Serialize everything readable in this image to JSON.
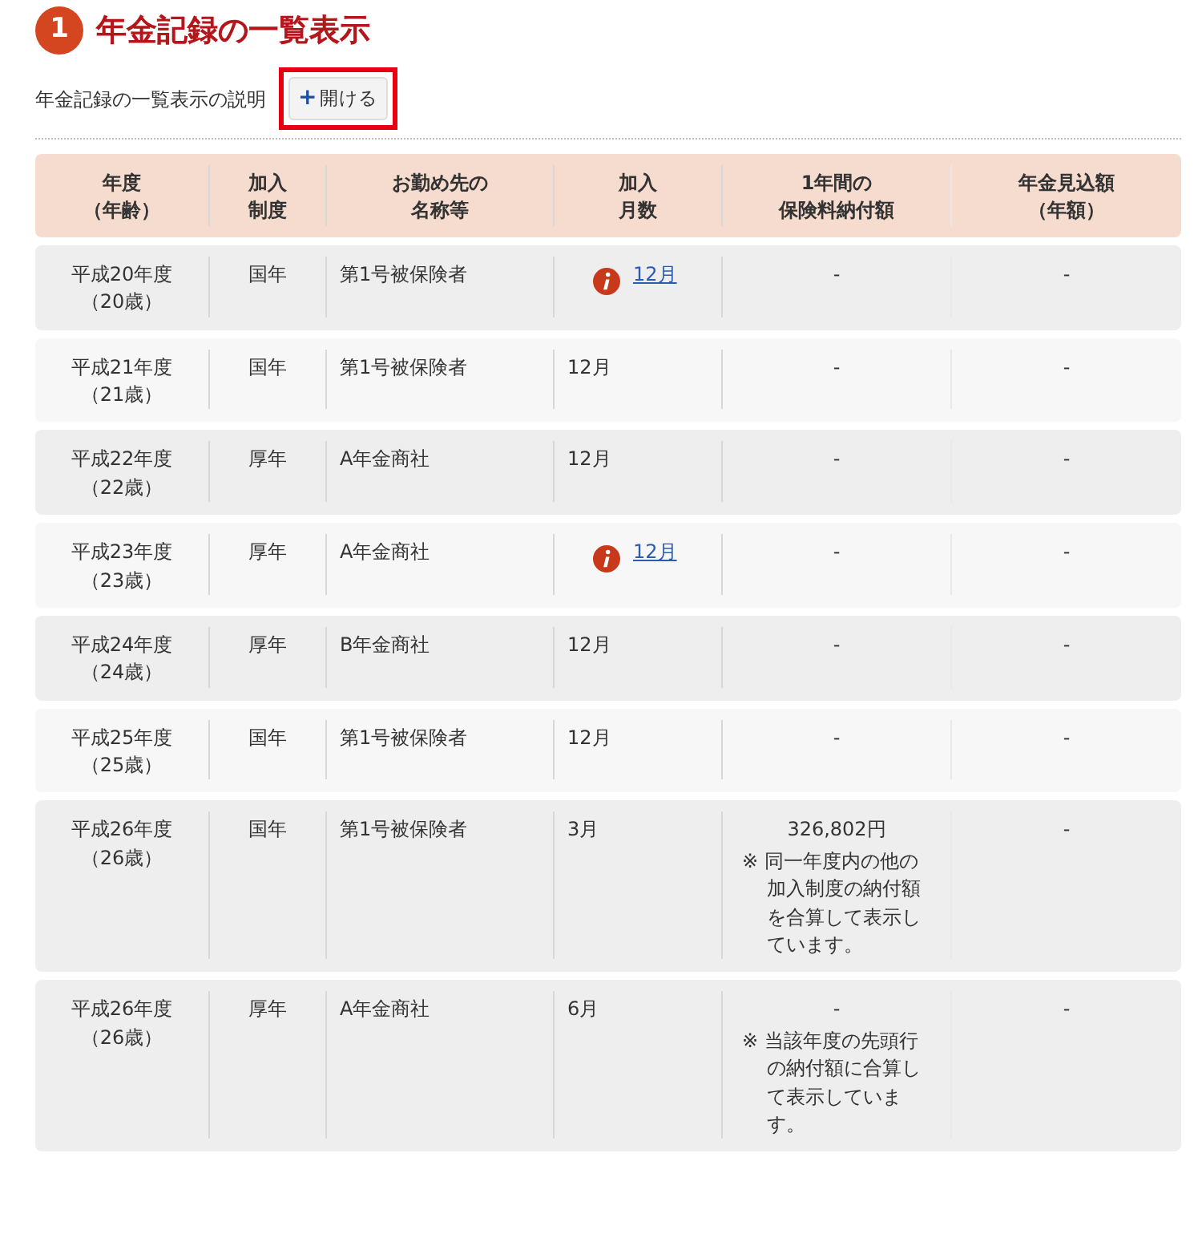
{
  "section": {
    "number": "1",
    "title": "年金記録の一覧表示"
  },
  "explanation": {
    "label": "年金記録の一覧表示の説明",
    "button_icon": "+",
    "button_label": "開ける",
    "highlighted": true
  },
  "table": {
    "columns": [
      {
        "lines": [
          "年度",
          "（年齢）"
        ]
      },
      {
        "lines": [
          "加入",
          "制度"
        ]
      },
      {
        "lines": [
          "お勤め先の",
          "名称等"
        ]
      },
      {
        "lines": [
          "加入",
          "月数"
        ]
      },
      {
        "lines": [
          "1年間の",
          "保険料納付額"
        ]
      },
      {
        "lines": [
          "年金見込額",
          "（年額）"
        ]
      }
    ],
    "rows": [
      {
        "year": "平成20年度",
        "age": "（20歳）",
        "system": "国年",
        "employer": "第1号被保険者",
        "months": "12月",
        "flagged": true,
        "payment": "-",
        "pension": "-",
        "shaded": true
      },
      {
        "year": "平成21年度",
        "age": "（21歳）",
        "system": "国年",
        "employer": "第1号被保険者",
        "months": "12月",
        "flagged": false,
        "payment": "-",
        "pension": "-",
        "shaded": false
      },
      {
        "year": "平成22年度",
        "age": "（22歳）",
        "system": "厚年",
        "employer": "A年金商社",
        "months": "12月",
        "flagged": false,
        "payment": "-",
        "pension": "-",
        "shaded": true
      },
      {
        "year": "平成23年度",
        "age": "（23歳）",
        "system": "厚年",
        "employer": "A年金商社",
        "months": "12月",
        "flagged": true,
        "payment": "-",
        "pension": "-",
        "shaded": false
      },
      {
        "year": "平成24年度",
        "age": "（24歳）",
        "system": "厚年",
        "employer": "B年金商社",
        "months": "12月",
        "flagged": false,
        "payment": "-",
        "pension": "-",
        "shaded": true
      },
      {
        "year": "平成25年度",
        "age": "（25歳）",
        "system": "国年",
        "employer": "第1号被保険者",
        "months": "12月",
        "flagged": false,
        "payment": "-",
        "pension": "-",
        "shaded": false
      },
      {
        "year": "平成26年度",
        "age": "（26歳）",
        "system": "国年",
        "employer": "第1号被保険者",
        "months": "3月",
        "flagged": false,
        "payment": "326,802円",
        "payment_note": "※ 同一年度内の他の加入制度の納付額を合算して表示しています。",
        "pension": "-",
        "shaded": true
      },
      {
        "year": "平成26年度",
        "age": "（26歳）",
        "system": "厚年",
        "employer": "A年金商社",
        "months": "6月",
        "flagged": false,
        "payment": "-",
        "payment_note": "※ 当該年度の先頭行の納付額に合算して表示しています。",
        "pension": "-",
        "shaded": true
      }
    ]
  }
}
